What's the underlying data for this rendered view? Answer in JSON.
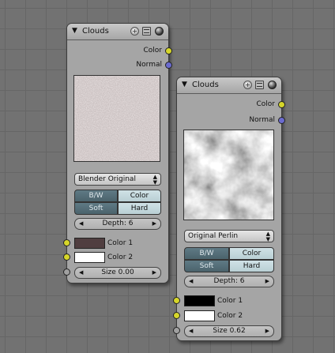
{
  "nodes": [
    {
      "title": "Clouds",
      "outputs": [
        "Color",
        "Normal"
      ],
      "noise_basis": "Blender Original",
      "bw_label": "B/W",
      "color_label": "Color",
      "soft_label": "Soft",
      "hard_label": "Hard",
      "depth": "Depth: 6",
      "color1_label": "Color 1",
      "color2_label": "Color 2",
      "size": "Size 0.00",
      "color1": "#503e40",
      "color2": "#ffffff"
    },
    {
      "title": "Clouds",
      "outputs": [
        "Color",
        "Normal"
      ],
      "noise_basis": "Original Perlin",
      "bw_label": "B/W",
      "color_label": "Color",
      "soft_label": "Soft",
      "hard_label": "Hard",
      "depth": "Depth: 6",
      "color1_label": "Color 1",
      "color2_label": "Color 2",
      "size": "Size 0.62",
      "color1": "#000000",
      "color2": "#ffffff"
    }
  ],
  "colors": {
    "color_socket": "#d6d62a",
    "normal_socket": "#6b6bcf",
    "value_socket": "#a0a0a0",
    "toggle_on": "#56707a",
    "toggle_off": "#c6dadf"
  },
  "icons": [
    "collapse-triangle-icon",
    "plus-icon",
    "list-icon",
    "sphere-icon"
  ]
}
